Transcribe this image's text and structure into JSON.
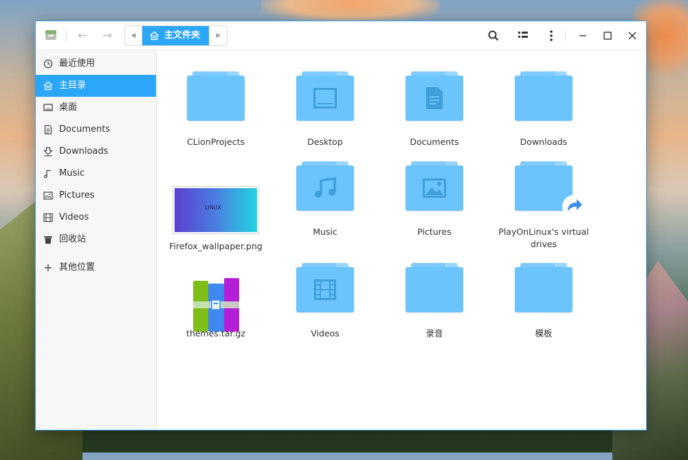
{
  "window": {
    "breadcrumb": {
      "current": "主文件夹"
    }
  },
  "sidebar": {
    "items": [
      {
        "label": "最近使用",
        "icon": "clock-icon"
      },
      {
        "label": "主目录",
        "icon": "home-icon",
        "active": true
      },
      {
        "label": "桌面",
        "icon": "desktop-icon"
      },
      {
        "label": "Documents",
        "icon": "document-icon"
      },
      {
        "label": "Downloads",
        "icon": "download-icon"
      },
      {
        "label": "Music",
        "icon": "music-icon"
      },
      {
        "label": "Pictures",
        "icon": "picture-icon"
      },
      {
        "label": "Videos",
        "icon": "video-icon"
      },
      {
        "label": "回收站",
        "icon": "trash-icon"
      }
    ],
    "other_locations": {
      "label": "其他位置",
      "icon": "plus-icon"
    }
  },
  "files": [
    {
      "name": "CLionProjects",
      "type": "folder",
      "emblem": ""
    },
    {
      "name": "Desktop",
      "type": "folder",
      "emblem": "desktop"
    },
    {
      "name": "Documents",
      "type": "folder",
      "emblem": "document"
    },
    {
      "name": "Downloads",
      "type": "folder",
      "emblem": ""
    },
    {
      "name": "Firefox_wallpaper.png",
      "type": "image",
      "thumb_text": "LINUX"
    },
    {
      "name": "Music",
      "type": "folder",
      "emblem": "music"
    },
    {
      "name": "Pictures",
      "type": "folder",
      "emblem": "picture"
    },
    {
      "name": "PlayOnLinux's virtual drives",
      "type": "folder",
      "emblem": "symlink"
    },
    {
      "name": "themes.tar.gz",
      "type": "archive"
    },
    {
      "name": "Videos",
      "type": "folder",
      "emblem": "video"
    },
    {
      "name": "录音",
      "type": "folder",
      "emblem": ""
    },
    {
      "name": "模板",
      "type": "folder",
      "emblem": ""
    }
  ],
  "colors": {
    "accent": "#2ca7f8",
    "folder": "#6cc4fc",
    "window_border": "#3b9ee8"
  }
}
